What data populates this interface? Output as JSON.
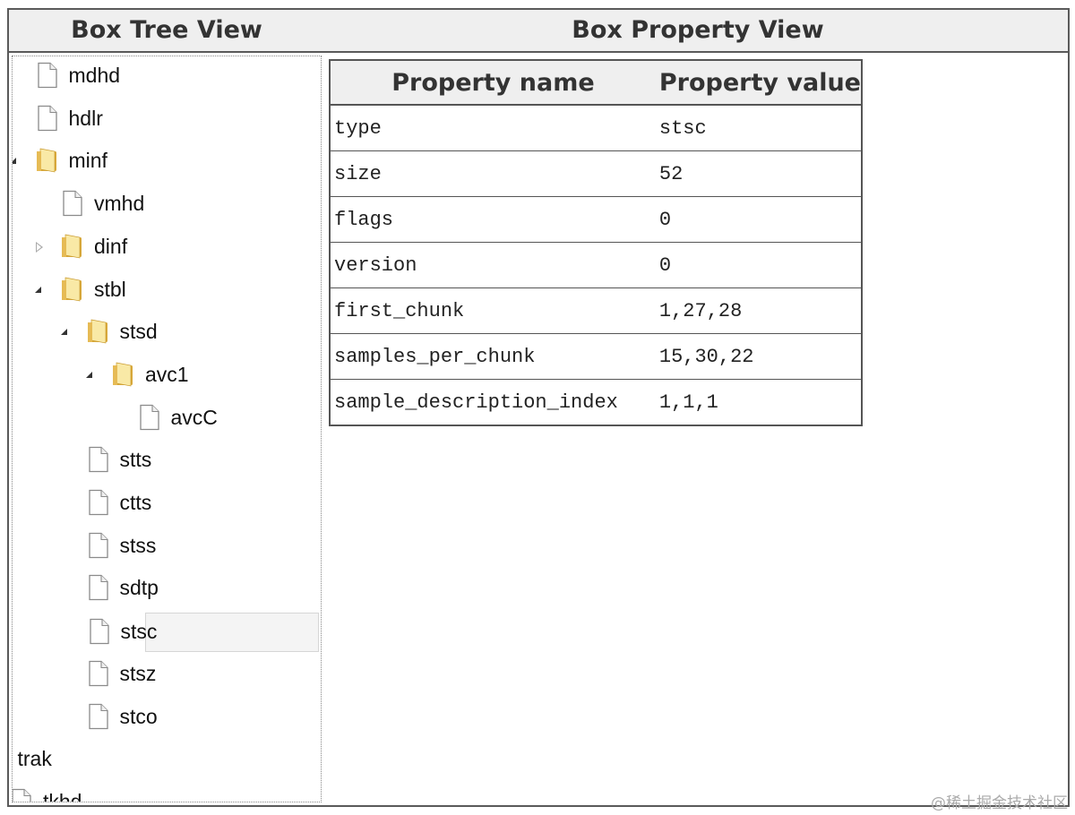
{
  "header": {
    "tree_title": "Box Tree View",
    "property_title": "Box Property View"
  },
  "tree": {
    "nodes": [
      {
        "label": "mdhd",
        "icon": "file-icon",
        "depth": 3,
        "expander": "none",
        "selected": false
      },
      {
        "label": "hdlr",
        "icon": "file-icon",
        "depth": 3,
        "expander": "none",
        "selected": false
      },
      {
        "label": "minf",
        "icon": "folder-icon",
        "depth": 3,
        "expander": "expanded",
        "selected": false
      },
      {
        "label": "vmhd",
        "icon": "file-icon",
        "depth": 4,
        "expander": "none",
        "selected": false
      },
      {
        "label": "dinf",
        "icon": "folder-icon",
        "depth": 4,
        "expander": "collapsed",
        "selected": false
      },
      {
        "label": "stbl",
        "icon": "folder-icon",
        "depth": 4,
        "expander": "expanded",
        "selected": false
      },
      {
        "label": "stsd",
        "icon": "folder-icon",
        "depth": 5,
        "expander": "expanded",
        "selected": false
      },
      {
        "label": "avc1",
        "icon": "folder-icon",
        "depth": 6,
        "expander": "expanded",
        "selected": false
      },
      {
        "label": "avcC",
        "icon": "file-icon",
        "depth": 7,
        "expander": "none",
        "selected": false
      },
      {
        "label": "stts",
        "icon": "file-icon",
        "depth": 5,
        "expander": "none",
        "selected": false
      },
      {
        "label": "ctts",
        "icon": "file-icon",
        "depth": 5,
        "expander": "none",
        "selected": false
      },
      {
        "label": "stss",
        "icon": "file-icon",
        "depth": 5,
        "expander": "none",
        "selected": false
      },
      {
        "label": "sdtp",
        "icon": "file-icon",
        "depth": 5,
        "expander": "none",
        "selected": false
      },
      {
        "label": "stsc",
        "icon": "file-icon",
        "depth": 5,
        "expander": "none",
        "selected": true
      },
      {
        "label": "stsz",
        "icon": "file-icon",
        "depth": 5,
        "expander": "none",
        "selected": false
      },
      {
        "label": "stco",
        "icon": "file-icon",
        "depth": 5,
        "expander": "none",
        "selected": false
      },
      {
        "label": "trak",
        "icon": "folder-icon",
        "depth": 1,
        "expander": "expanded",
        "selected": false
      },
      {
        "label": "tkhd",
        "icon": "file-icon",
        "depth": 2,
        "expander": "none",
        "selected": false
      }
    ]
  },
  "property_table": {
    "headers": {
      "name": "Property name",
      "value": "Property value"
    },
    "rows": [
      {
        "name": "type",
        "value": "stsc"
      },
      {
        "name": "size",
        "value": "52"
      },
      {
        "name": "flags",
        "value": "0"
      },
      {
        "name": "version",
        "value": "0"
      },
      {
        "name": "first_chunk",
        "value": "1,27,28"
      },
      {
        "name": "samples_per_chunk",
        "value": "15,30,22"
      },
      {
        "name": "sample_description_index",
        "value": "1,1,1"
      }
    ]
  },
  "watermark": "@稀土掘金技术社区"
}
